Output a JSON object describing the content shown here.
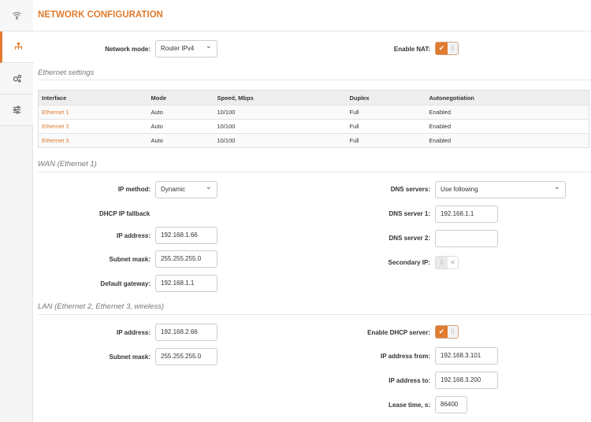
{
  "title": "NETWORK CONFIGURATION",
  "sidebar": [
    {
      "icon": "wifi-icon"
    },
    {
      "icon": "network-icon",
      "active": true
    },
    {
      "icon": "gears-icon"
    },
    {
      "icon": "sliders-icon"
    }
  ],
  "network_mode": {
    "label": "Network mode:",
    "value": "Router IPv4"
  },
  "nat": {
    "label": "Enable NAT:",
    "enabled": true
  },
  "ethernet": {
    "heading": "Ethernet settings",
    "columns": [
      "Interface",
      "Mode",
      "Speed, Mbps",
      "Duplex",
      "Autonegotiation"
    ],
    "rows": [
      [
        "Ethernet 1",
        "Auto",
        "10/100",
        "Full",
        "Enabled"
      ],
      [
        "Ethernet 2",
        "Auto",
        "10/100",
        "Full",
        "Enabled"
      ],
      [
        "Ethernet 3",
        "Auto",
        "10/100",
        "Full",
        "Enabled"
      ]
    ]
  },
  "wan": {
    "heading": "WAN (Ethernet 1)",
    "ip_method_label": "IP method:",
    "ip_method": "Dynamic",
    "fallback": "DHCP IP fallback",
    "ip_label": "IP address:",
    "ip": "192.168.1.66",
    "mask_label": "Subnet mask:",
    "mask": "255.255.255.0",
    "gw_label": "Default gateway:",
    "gw": "192.168.1.1",
    "dns_label": "DNS servers:",
    "dns": "Use following",
    "dns1_label": "DNS server 1:",
    "dns1": "192.168.1.1",
    "dns2_label": "DNS server 2:",
    "dns2": "",
    "secondary_label": "Secondary IP:",
    "secondary_enabled": false
  },
  "lan": {
    "heading": "LAN (Ethernet 2, Ethernet 3, wireless)",
    "ip_label": "IP address:",
    "ip": "192.168.2.66",
    "mask_label": "Subnet mask:",
    "mask": "255.255.255.0",
    "dhcp_label": "Enable DHCP server:",
    "dhcp_enabled": true,
    "from_label": "IP address from:",
    "from": "192.168.3.101",
    "to_label": "IP address to:",
    "to": "192.168.3.200",
    "lease_label": "Lease time, s:",
    "lease": "86400"
  }
}
